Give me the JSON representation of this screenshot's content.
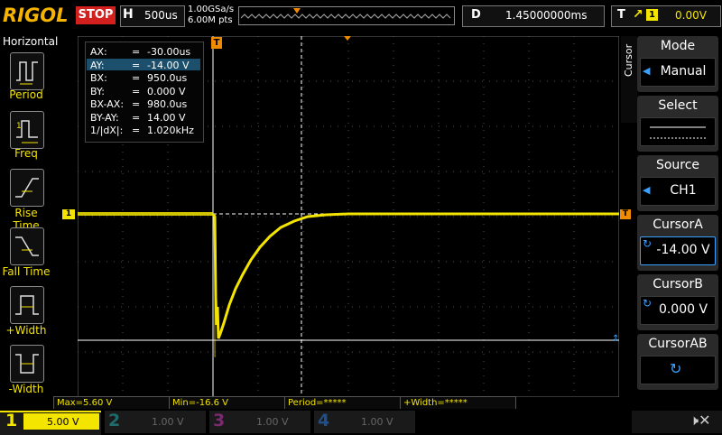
{
  "top": {
    "logo": "RIGOL",
    "run_state": "STOP",
    "h_label": "H",
    "h_value": "500us",
    "sample_rate": "1.00GSa/s",
    "mem_depth": "6.00M pts",
    "d_label": "D",
    "d_value": "1.45000000ms",
    "t_label": "T",
    "t_channel": "1",
    "t_level": "0.00V"
  },
  "left_menu": {
    "title": "Horizontal",
    "items": [
      {
        "label": "Period"
      },
      {
        "label": "Freq"
      },
      {
        "label": "Rise Time"
      },
      {
        "label": "Fall Time"
      },
      {
        "label": "+Width"
      },
      {
        "label": "-Width"
      }
    ]
  },
  "cursor_readout": {
    "rows": [
      {
        "k": "AX:",
        "eq": "=",
        "v": "-30.00us"
      },
      {
        "k": "AY:",
        "eq": "=",
        "v": "-14.00 V"
      },
      {
        "k": "BX:",
        "eq": "=",
        "v": "950.0us"
      },
      {
        "k": "BY:",
        "eq": "=",
        "v": "0.000 V"
      },
      {
        "k": "BX-AX:",
        "eq": "=",
        "v": "980.0us"
      },
      {
        "k": "BY-AY:",
        "eq": "=",
        "v": "14.00 V"
      },
      {
        "k": "1/|dX|:",
        "eq": "=",
        "v": "1.020kHz"
      }
    ]
  },
  "markers": {
    "trigger_marker": "T",
    "ch1_marker": "1",
    "trig_level_marker": "T"
  },
  "right_menu": {
    "tab": "Cursor",
    "items": [
      {
        "title": "Mode",
        "value": "Manual"
      },
      {
        "title": "Select",
        "value": ""
      },
      {
        "title": "Source",
        "value": "CH1"
      },
      {
        "title": "CursorA",
        "value": "-14.00 V"
      },
      {
        "title": "CursorB",
        "value": "0.000 V"
      },
      {
        "title": "CursorAB",
        "value": ""
      }
    ]
  },
  "measurements": [
    {
      "label": "Max=5.60 V"
    },
    {
      "label": "Min=-16.6 V"
    },
    {
      "label": "Period=*****"
    },
    {
      "label": "+Width=*****"
    }
  ],
  "channels": [
    {
      "num": "1",
      "scale": "5.00 V",
      "color": "#f4e500",
      "active": true
    },
    {
      "num": "2",
      "scale": "1.00 V",
      "color": "#1f6b6b",
      "active": false
    },
    {
      "num": "3",
      "scale": "1.00 V",
      "color": "#7a2a6e",
      "active": false
    },
    {
      "num": "4",
      "scale": "1.00 V",
      "color": "#1f4f8a",
      "active": false
    }
  ],
  "colors": {
    "trace": "#f4e500",
    "accent": "#f4b400",
    "stop": "#d2201f",
    "marker": "#f08a00"
  }
}
